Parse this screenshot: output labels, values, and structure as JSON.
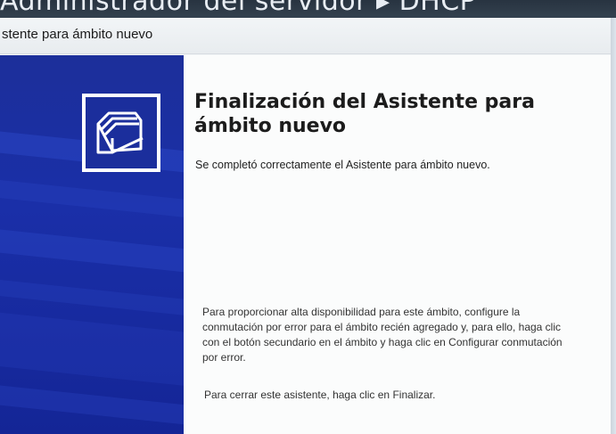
{
  "background_window": {
    "title": "Administrador del servidor ▸ DHCP"
  },
  "wizard": {
    "title": "stente para ámbito nuevo",
    "heading_line1": "Finalización del Asistente para",
    "heading_line2": "ámbito nuevo",
    "completed_message": "Se completó correctamente el Asistente para ámbito nuevo.",
    "failover_message": "Para proporcionar alta disponibilidad para este ámbito, configure la conmutación por error para el ámbito recién agregado y, para ello, haga clic con el botón secundario en el ámbito y haga clic en Configurar conmutación por error.",
    "close_message": "Para cerrar este asistente, haga clic en Finalizar.",
    "icon": "folders-icon"
  },
  "colors": {
    "banner_blue": "#1a2fa8",
    "content_bg": "#fbfcfc"
  }
}
